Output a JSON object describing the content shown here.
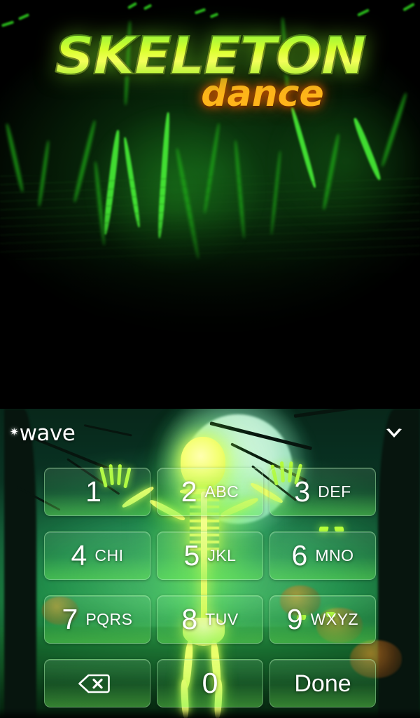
{
  "preview": {
    "title_main": "SKELETON",
    "title_sub": "dance",
    "title_main_color": "#d9ff2e",
    "title_sub_color": "#ffb51a"
  },
  "keypad": {
    "brand": {
      "star": "✷",
      "name": "wave"
    },
    "collapse_icon": "chevron-down-icon",
    "accent_color": "#7cf06a",
    "key_text_color": "#ffffff",
    "keys": [
      {
        "digit": "1",
        "letters": ""
      },
      {
        "digit": "2",
        "letters": "ABC"
      },
      {
        "digit": "3",
        "letters": "DEF"
      },
      {
        "digit": "4",
        "letters": "CHI"
      },
      {
        "digit": "5",
        "letters": "JKL"
      },
      {
        "digit": "6",
        "letters": "MNO"
      },
      {
        "digit": "7",
        "letters": "PQRS"
      },
      {
        "digit": "8",
        "letters": "TUV"
      },
      {
        "digit": "9",
        "letters": "WXYZ"
      }
    ],
    "backspace_label": "",
    "zero_digit": "0",
    "done_label": "Done"
  }
}
